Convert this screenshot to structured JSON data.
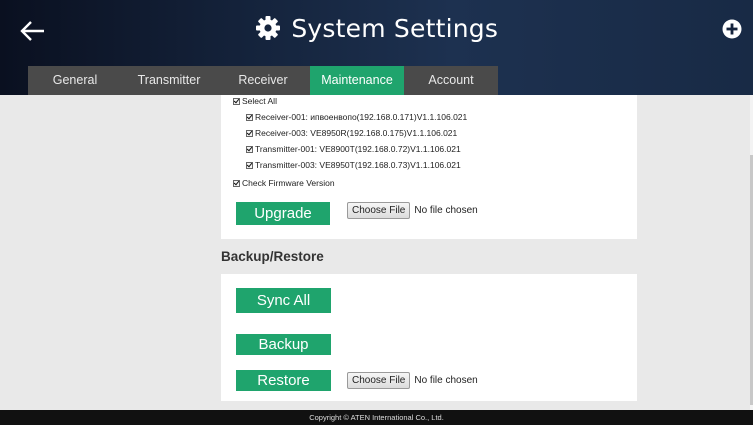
{
  "header": {
    "title": "System Settings",
    "back_icon": "arrow-left-icon",
    "settings_icon": "gear-icon",
    "add_icon": "plus-circle-icon"
  },
  "tabs": [
    {
      "label": "General",
      "active": false
    },
    {
      "label": "Transmitter",
      "active": false
    },
    {
      "label": "Receiver",
      "active": false
    },
    {
      "label": "Maintenance",
      "active": true
    },
    {
      "label": "Account",
      "active": false
    }
  ],
  "firmware": {
    "select_all": "Select All",
    "devices": [
      "Receiver-001: ипвоенвопо(192.168.0.171)V1.1.106.021",
      "Receiver-003: VE8950R(192.168.0.175)V1.1.106.021",
      "Transmitter-001: VE8900T(192.168.0.72)V1.1.106.021",
      "Transmitter-003: VE8950T(192.168.0.73)V1.1.106.021"
    ],
    "check_firmware": "Check Firmware Version",
    "upgrade_label": "Upgrade",
    "choose_file_label": "Choose File",
    "no_file_text": "No file chosen"
  },
  "backup": {
    "section_title": "Backup/Restore",
    "sync_all_label": "Sync All",
    "backup_label": "Backup",
    "restore_label": "Restore",
    "choose_file_label": "Choose File",
    "no_file_text": "No file chosen"
  },
  "footer": {
    "copyright": "Copyright © ATEN International Co., Ltd."
  },
  "colors": {
    "accent": "#1fa46d",
    "tab_bg": "#4a4a4a",
    "header_dark": "#0a1020",
    "header_mid": "#1d3150"
  }
}
